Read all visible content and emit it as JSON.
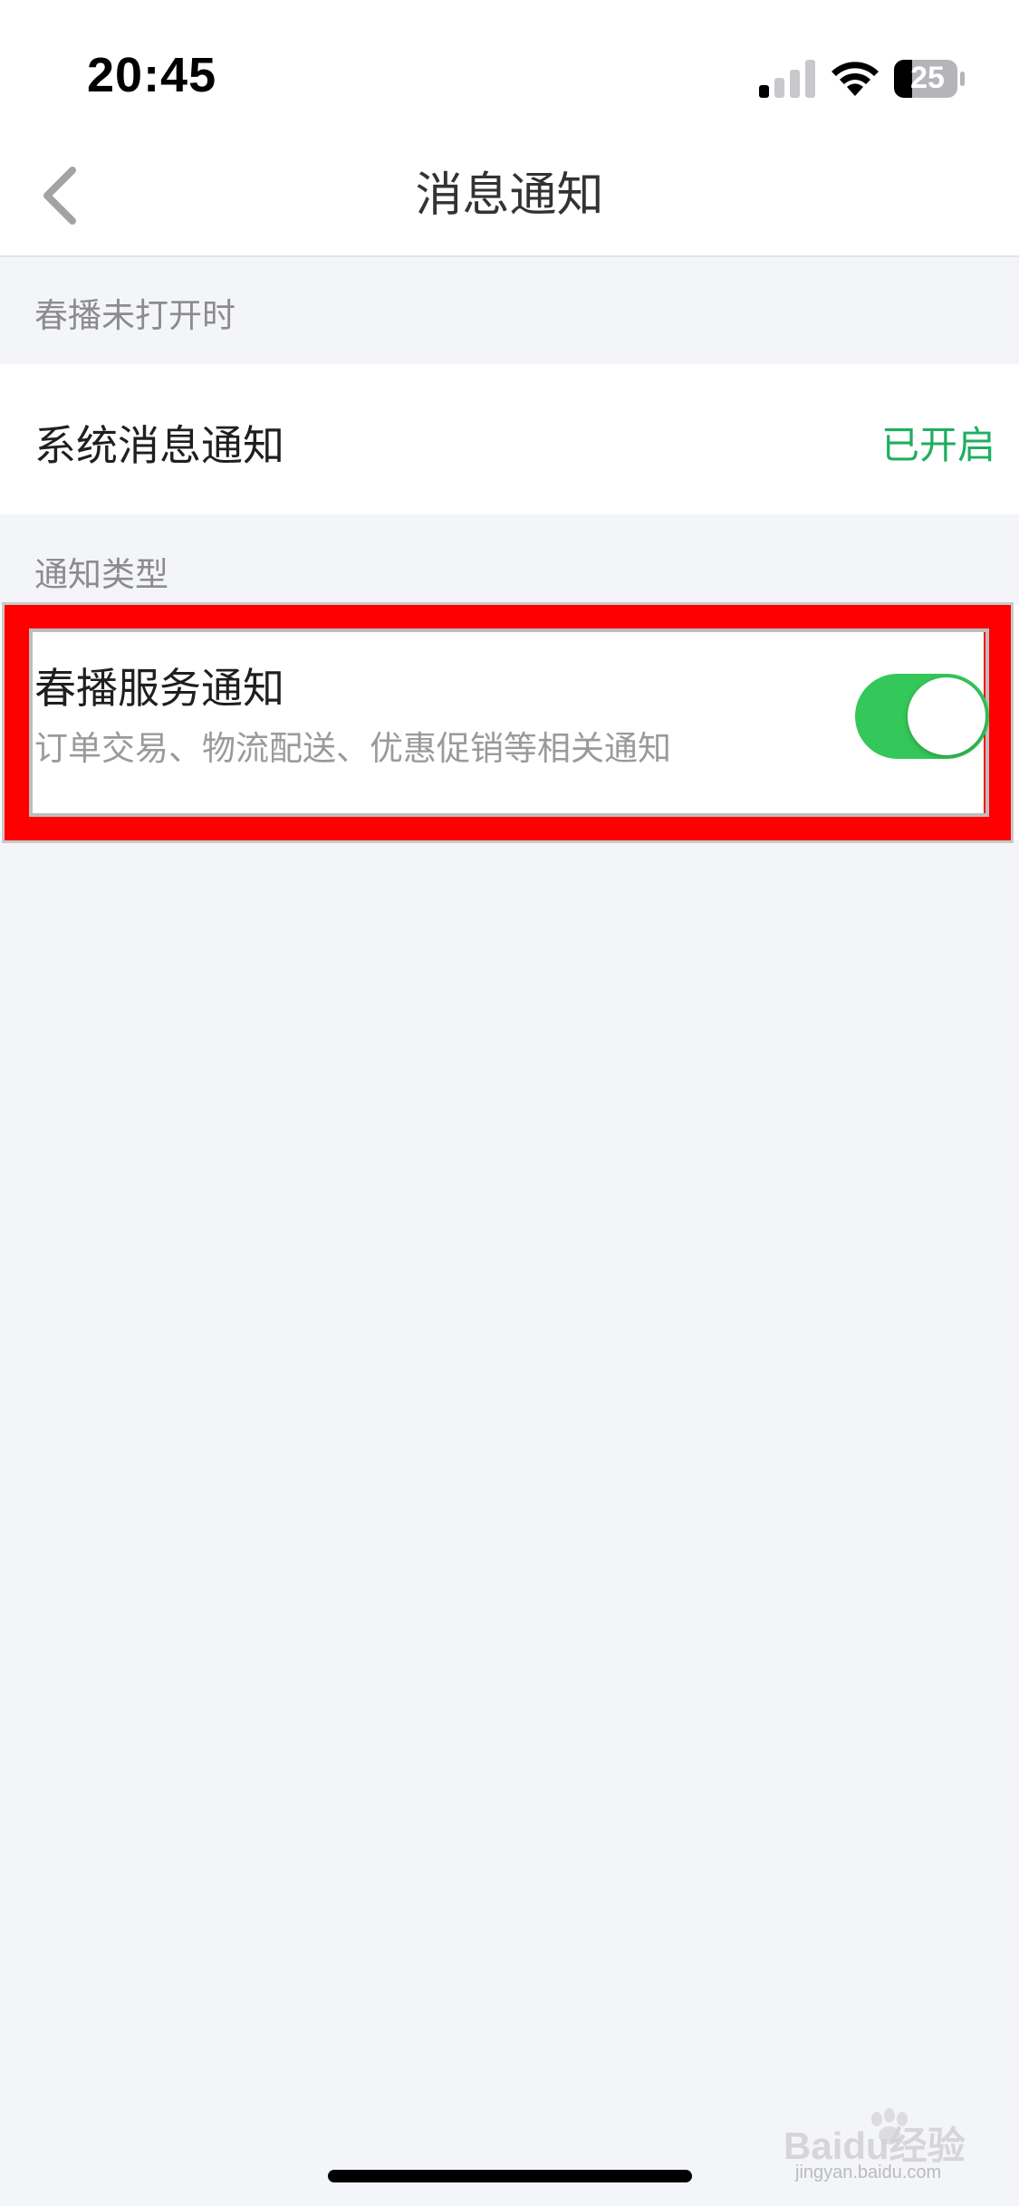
{
  "status_bar": {
    "time": "20:45",
    "battery_level": "25",
    "signal_icon": "cellular-signal-icon",
    "wifi_icon": "wifi-icon",
    "battery_icon": "battery-icon"
  },
  "nav": {
    "title": "消息通知",
    "back_icon": "chevron-left-icon"
  },
  "sections": {
    "system": {
      "header": "春播未打开时",
      "row_title": "系统消息通知",
      "row_value": "已开启"
    },
    "types": {
      "header": "通知类型",
      "row_title": "春播服务通知",
      "row_subtitle": "订单交易、物流配送、优惠促销等相关通知",
      "toggle_on": true
    }
  },
  "watermark": {
    "text": "Baidu经验",
    "sub": "jingyan.baidu.com"
  },
  "colors": {
    "accent_green": "#1fae61",
    "toggle_green": "#34c759",
    "highlight_red": "#ff0000",
    "background": "#f4f5f9"
  }
}
